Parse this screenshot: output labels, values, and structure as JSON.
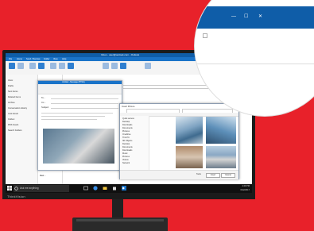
{
  "monitor": {
    "brand": "ThinkVision"
  },
  "outlook": {
    "title": "Inbox - user@outlook.com - Outlook",
    "tabs": [
      "File",
      "Home",
      "Send / Receive",
      "Folder",
      "View",
      "Help"
    ],
    "folders": [
      "Inbox",
      "Drafts",
      "Sent Items",
      "Deleted Items",
      "Archive",
      "Conversation History",
      "Junk Email",
      "Outbox",
      "RSS Feeds",
      "Search Folders"
    ],
    "messages": [
      "Cynthia ...",
      "Jeffery M.",
      "Allen T.",
      "Kara D.",
      "Robert ...",
      "Lisa ...",
      "Sam ...",
      "Ted ...",
      "Jane ...",
      "Mark ..."
    ]
  },
  "compose": {
    "title": "Untitled - Message (HTML)",
    "to_label": "To...",
    "cc_label": "Cc...",
    "subject_label": "Subject"
  },
  "dialog": {
    "title": "Insert Picture",
    "nav_items": [
      "Quick access",
      "Desktop",
      "Downloads",
      "Documents",
      "Pictures",
      "OneDrive",
      "This PC",
      "3D Objects",
      "Desktop",
      "Documents",
      "Downloads",
      "Music",
      "Pictures",
      "Videos",
      "Network"
    ],
    "insert_button": "Insert",
    "cancel_button": "Cancel",
    "tools_label": "Tools"
  },
  "taskbar": {
    "search_placeholder": "Ask me anything",
    "time": "4:40 PM",
    "date": "6/12/2017"
  },
  "magnifier": {
    "minimize": "—",
    "maximize": "☐",
    "close": "✕"
  },
  "colors": {
    "background": "#e8212a",
    "outlook_blue": "#0f5da8"
  }
}
